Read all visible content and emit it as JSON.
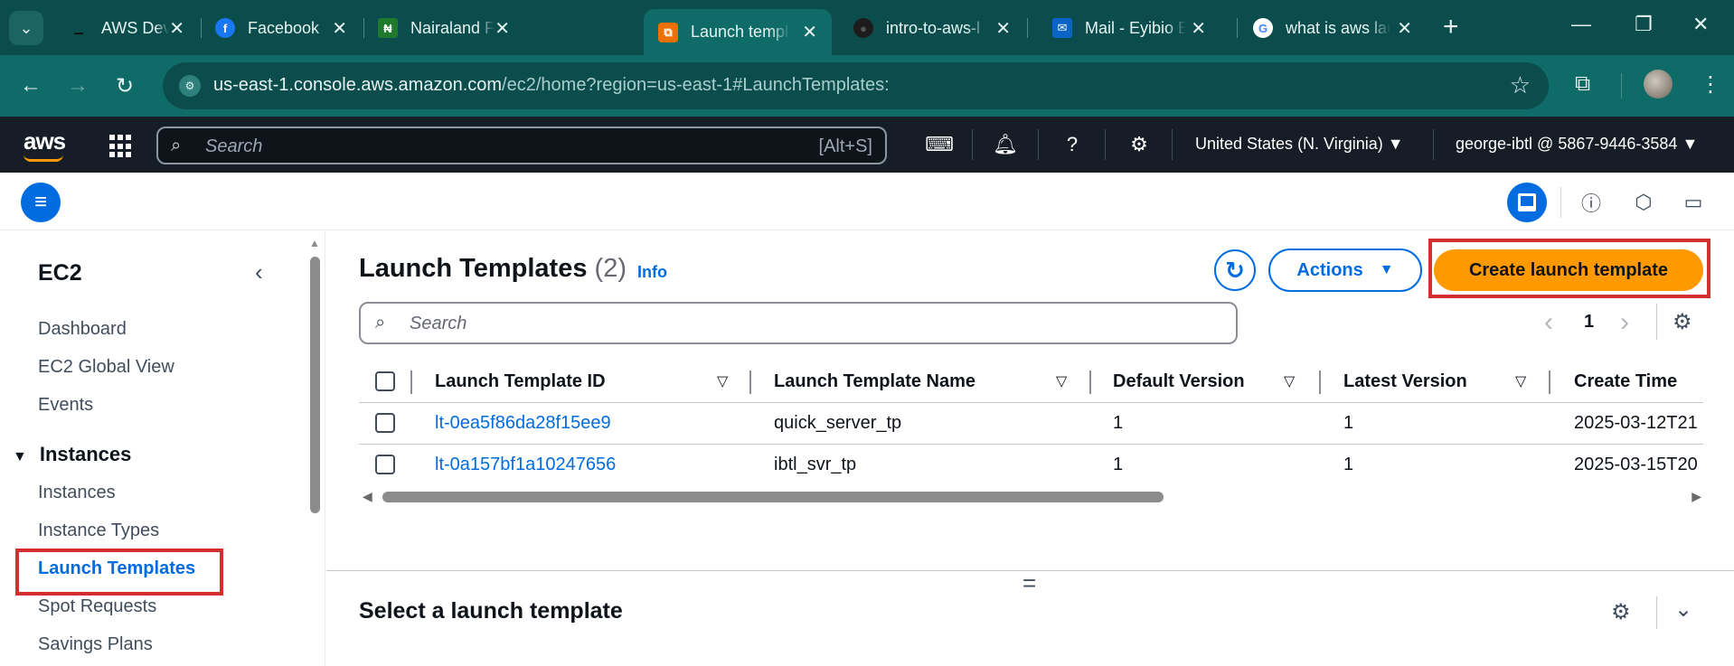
{
  "browser": {
    "tabs": [
      {
        "title": "AWS DevOps | Learn",
        "favicon": "aws-devops-favicon",
        "active": false
      },
      {
        "title": "Facebook",
        "favicon": "facebook-favicon",
        "active": false
      },
      {
        "title": "Nairaland Forum",
        "favicon": "nairaland-favicon",
        "active": false
      },
      {
        "title": "Launch templates",
        "favicon": "aws-ec2-favicon",
        "active": true
      },
      {
        "title": "intro-to-aws-l",
        "favicon": "github-favicon",
        "active": false
      },
      {
        "title": "Mail - Eyibio E",
        "favicon": "outlook-favicon",
        "active": false
      },
      {
        "title": "what is aws lau",
        "favicon": "google-favicon",
        "active": false
      }
    ],
    "url_host": "us-east-1.console.aws.amazon.com",
    "url_path": "/ec2/home?region=us-east-1#LaunchTemplates:"
  },
  "aws_nav": {
    "logo": "aws",
    "search_placeholder": "Search",
    "search_shortcut": "[Alt+S]",
    "region": "United States (N. Virginia) ▼",
    "account": "george-ibtl @ 5867-9446-3584 ▼"
  },
  "sidebar": {
    "title": "EC2",
    "items": [
      {
        "label": "Dashboard"
      },
      {
        "label": "EC2 Global View"
      },
      {
        "label": "Events"
      }
    ],
    "section": "Instances",
    "section_items": [
      {
        "label": "Instances"
      },
      {
        "label": "Instance Types"
      },
      {
        "label": "Launch Templates"
      },
      {
        "label": "Spot Requests"
      },
      {
        "label": "Savings Plans"
      }
    ]
  },
  "main": {
    "title": "Launch Templates",
    "count": "(2)",
    "info": "Info",
    "actions_label": "Actions",
    "create_label": "Create launch template",
    "search_placeholder": "Search",
    "page": "1",
    "columns": [
      "Launch Template ID",
      "Launch Template Name",
      "Default Version",
      "Latest Version",
      "Create Time"
    ],
    "rows": [
      {
        "id": "lt-0ea5f86da28f15ee9",
        "name": "quick_server_tp",
        "default_version": "1",
        "latest_version": "1",
        "create_time": "2025-03-12T21"
      },
      {
        "id": "lt-0a157bf1a10247656",
        "name": "ibtl_svr_tp",
        "default_version": "1",
        "latest_version": "1",
        "create_time": "2025-03-15T20"
      }
    ],
    "split_handle": "=",
    "bottom_title": "Select a launch template"
  },
  "colors": {
    "browser_frame": "#0b4d4c",
    "aws_nav": "#161d26",
    "link": "#006ce0",
    "primary_button": "#ff9900",
    "highlight": "#d32f2f"
  }
}
